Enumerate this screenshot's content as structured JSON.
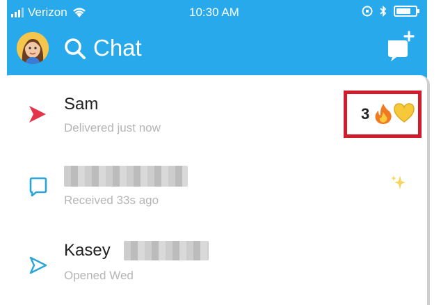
{
  "status_bar": {
    "carrier": "Verizon",
    "time": "10:30 AM",
    "battery_level": 0.75
  },
  "nav": {
    "title": "Chat"
  },
  "chats": [
    {
      "name": "Sam",
      "status": "Delivered just now",
      "icon": "sent-arrow-filled-icon",
      "icon_color": "#e3354a",
      "streak_count": "3"
    },
    {
      "name": "",
      "status": "Received 33s ago",
      "icon": "chat-bubble-icon",
      "icon_color": "#2aa5d8",
      "badge": "sparkle"
    },
    {
      "name": "Kasey",
      "status": "Opened Wed",
      "icon": "sent-arrow-outline-icon",
      "icon_color": "#2aa5d8"
    }
  ],
  "colors": {
    "header": "#27a9ec",
    "highlight_border": "#d11c2c"
  }
}
